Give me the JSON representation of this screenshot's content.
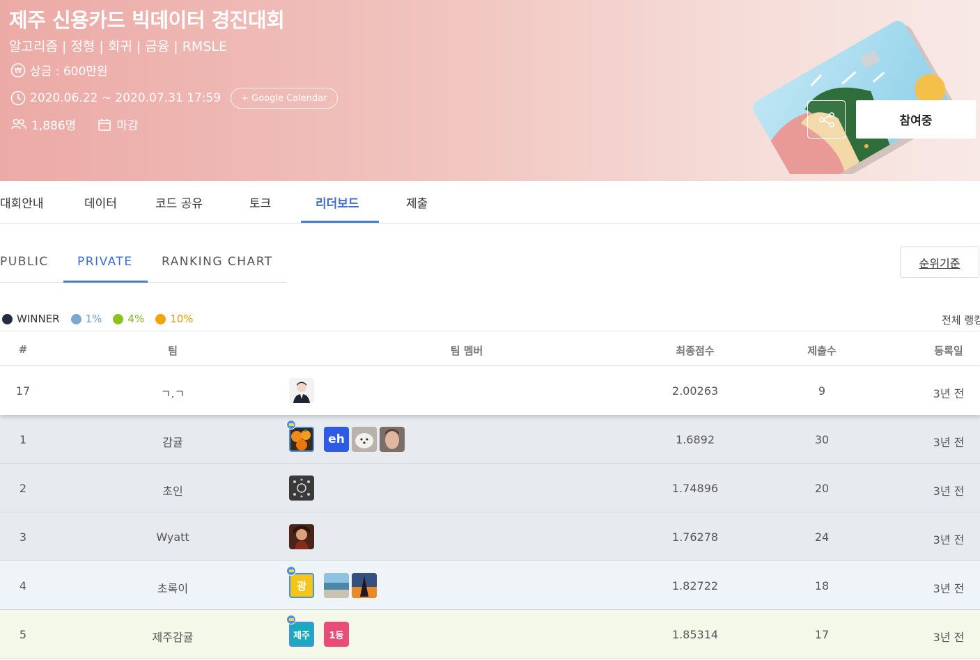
{
  "competition": {
    "title": "제주 신용카드 빅데이터 경진대회",
    "tags": "알고리즘 | 정형 | 회귀 | 금융 | RMSLE",
    "prize": "상금 : 600만원",
    "period": "2020.06.22 ~ 2020.07.31 17:59",
    "google_calendar": "+ Google Calendar",
    "participants": "1,886명",
    "status": "마감",
    "join_label": "참여중"
  },
  "main_tabs": [
    {
      "label": "대회안내"
    },
    {
      "label": "데이터"
    },
    {
      "label": "코드 공유"
    },
    {
      "label": "토크"
    },
    {
      "label": "리더보드",
      "active": true
    },
    {
      "label": "제출"
    }
  ],
  "sub_tabs": [
    {
      "label": "PUBLIC"
    },
    {
      "label": "PRIVATE",
      "active": true
    },
    {
      "label": "RANKING CHART"
    }
  ],
  "rank_basis_label": "순위기준",
  "legend": [
    {
      "label": "WINNER",
      "color": "#1f2d3d"
    },
    {
      "label": "1%",
      "color": "#7ba7d1"
    },
    {
      "label": "4%",
      "color": "#8cc21f"
    },
    {
      "label": "10%",
      "color": "#f0a30a"
    }
  ],
  "all_ranking_label": "전체 랭킹",
  "table": {
    "headers": {
      "rank": "#",
      "team": "팀",
      "members": "팀 멤버",
      "score": "최종점수",
      "submissions": "제출수",
      "registered": "등록일"
    },
    "my_row": {
      "rank": "17",
      "team": "ㄱ.ㄱ",
      "score": "2.00263",
      "submissions": "9",
      "registered": "3년 전"
    },
    "rows": [
      {
        "rank": "1",
        "team": "감귤",
        "score": "1.6892",
        "submissions": "30",
        "registered": "3년 전",
        "tier": "winner"
      },
      {
        "rank": "2",
        "team": "초인",
        "score": "1.74896",
        "submissions": "20",
        "registered": "3년 전",
        "tier": "winner"
      },
      {
        "rank": "3",
        "team": "Wyatt",
        "score": "1.76278",
        "submissions": "24",
        "registered": "3년 전",
        "tier": "winner"
      },
      {
        "rank": "4",
        "team": "초록이",
        "score": "1.82722",
        "submissions": "18",
        "registered": "3년 전",
        "tier": "1%"
      },
      {
        "rank": "5",
        "team": "제주감귤",
        "score": "1.85314",
        "submissions": "17",
        "registered": "3년 전",
        "tier": "4%"
      }
    ],
    "avatar_text": {
      "eh": "eh",
      "gwang": "광",
      "jeju": "제주",
      "first": "1등"
    }
  }
}
